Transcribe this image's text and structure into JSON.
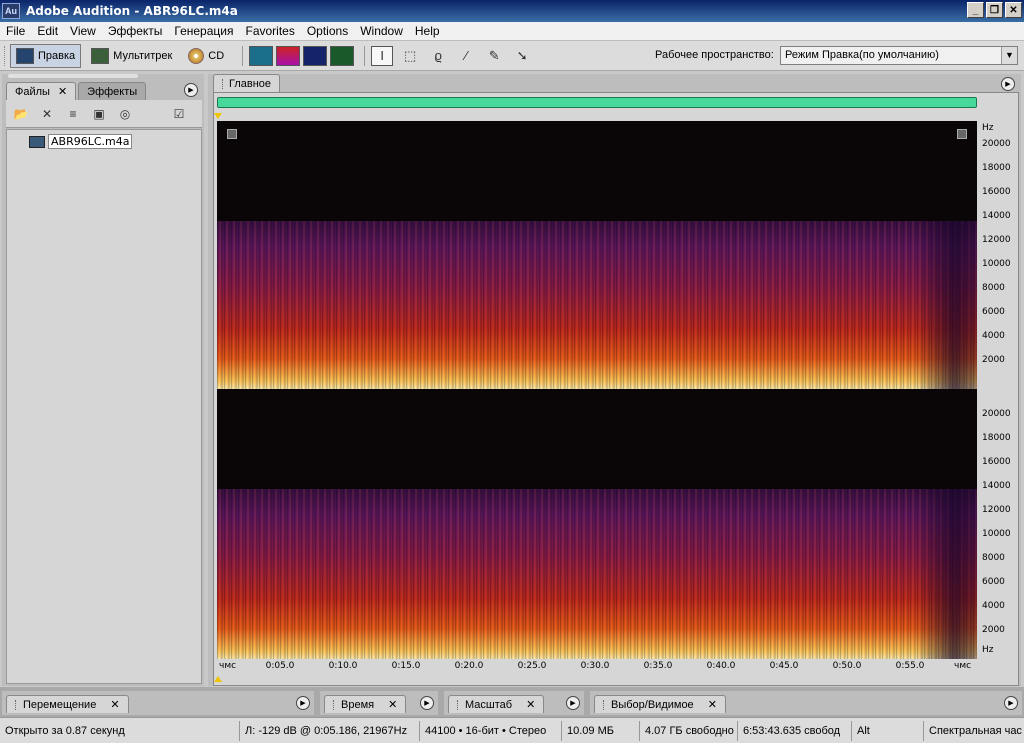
{
  "window": {
    "app_icon": "Au",
    "title": "Adobe Audition - ABR96LC.m4a",
    "minimize": "_",
    "restore": "❐",
    "close": "✕"
  },
  "menu": [
    "File",
    "Edit",
    "View",
    "Эффекты",
    "Генерация",
    "Favorites",
    "Options",
    "Window",
    "Help"
  ],
  "toolbar": {
    "mode_edit": "Правка",
    "mode_multitrack": "Мультитрек",
    "mode_cd": "CD",
    "workspace_label": "Рабочее пространство:",
    "workspace_value": "Режим Правка(по умолчанию)"
  },
  "left_panel": {
    "tab_files": "Файлы",
    "tab_effects": "Эффекты",
    "close_glyph": "✕",
    "files": [
      "ABR96LC.m4a"
    ]
  },
  "main_panel": {
    "tab_main": "Главное",
    "freq_unit": "Hz",
    "freq_labels_ch1": [
      "20000",
      "18000",
      "16000",
      "14000",
      "12000",
      "10000",
      "8000",
      "6000",
      "4000",
      "2000"
    ],
    "freq_labels_ch2": [
      "20000",
      "18000",
      "16000",
      "14000",
      "12000",
      "10000",
      "8000",
      "6000",
      "4000",
      "2000"
    ],
    "time_unit_left": "чмс",
    "time_unit_right": "чмс",
    "time_labels": [
      "0:05.0",
      "0:10.0",
      "0:15.0",
      "0:20.0",
      "0:25.0",
      "0:30.0",
      "0:35.0",
      "0:40.0",
      "0:45.0",
      "0:50.0",
      "0:55.0"
    ]
  },
  "bottom_panels": {
    "transport": "Перемещение",
    "time": "Время",
    "zoom": "Масштаб",
    "selection": "Выбор/Видимое",
    "close_glyph": "✕"
  },
  "status": {
    "opened": "Открыто за 0.87 секунд",
    "cursor": "Л: -129 dB @ 0:05.186, 21967Hz",
    "format": "44100 • 16-бит • Стерео",
    "size": "10.09 МБ",
    "free": "4.07 ГБ свободно",
    "free_time": "6:53:43.635 свобод",
    "key": "Alt",
    "view": "Спектральная час"
  },
  "colors": {
    "spectro_bg": "#0a0608",
    "spectro_hot": "#ffd36a",
    "spectro_mid": "#e03a1a",
    "spectro_low": "#5a1a6a",
    "overview": "#46d99a",
    "cursor": "#f0c400"
  }
}
